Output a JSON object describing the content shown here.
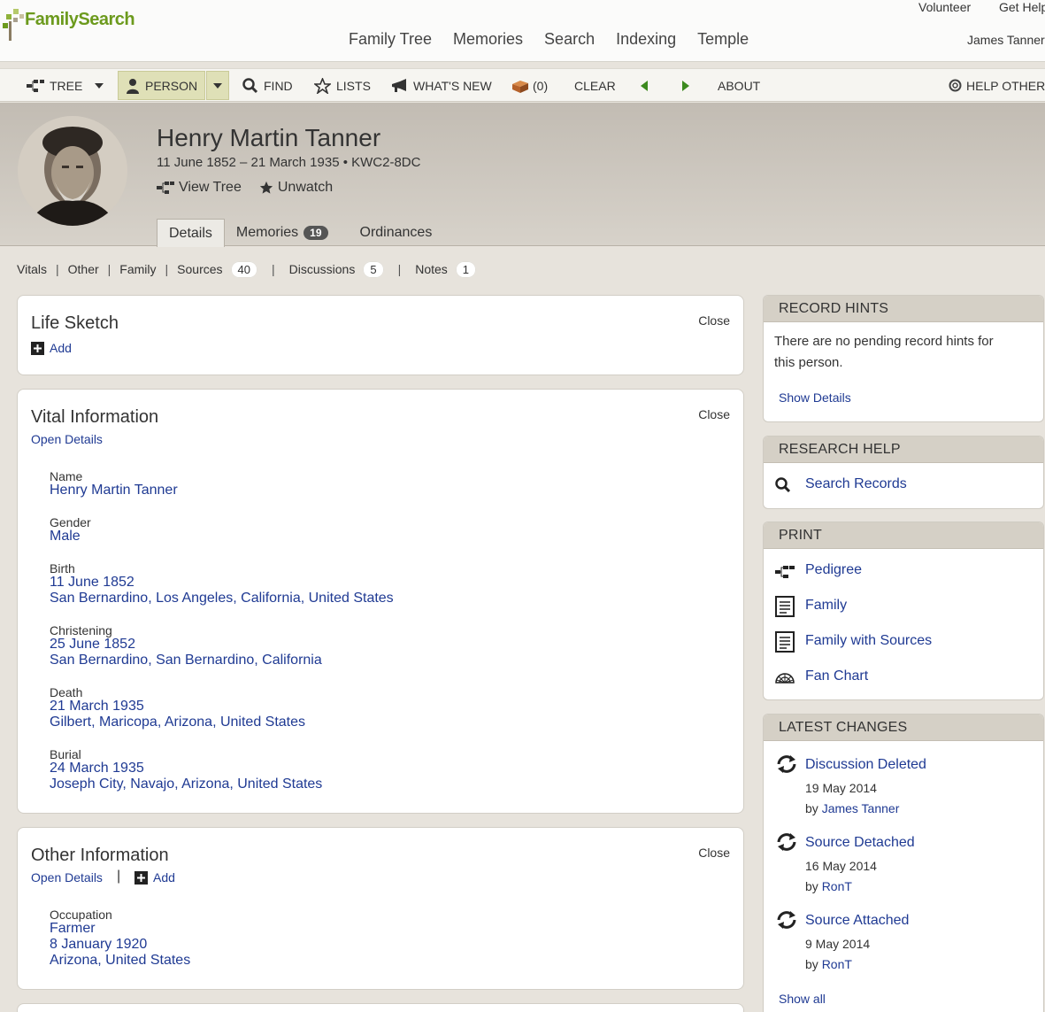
{
  "header": {
    "logo_text": "FamilySearch",
    "nav": [
      "Family Tree",
      "Memories",
      "Search",
      "Indexing",
      "Temple"
    ],
    "utility": [
      "Volunteer",
      "Get Help"
    ],
    "user_name": "James Tanner"
  },
  "toolbar": {
    "tree": "TREE",
    "person": "PERSON",
    "find": "FIND",
    "lists": "LISTS",
    "whats_new": "WHAT'S NEW",
    "clipboard": "(0)",
    "clear": "CLEAR",
    "about": "ABOUT",
    "help_others": "HELP OTHERS"
  },
  "person": {
    "name": "Henry Martin Tanner",
    "summary": "11 June 1852 – 21 March 1935 • KWC2-8DC",
    "view_tree": "View Tree",
    "unwatch": "Unwatch",
    "tabs": [
      {
        "label": "Details"
      },
      {
        "label": "Memories",
        "count": "19"
      },
      {
        "label": "Ordinances"
      }
    ]
  },
  "subnav": [
    {
      "label": "Vitals"
    },
    {
      "label": "Other"
    },
    {
      "label": "Family"
    },
    {
      "label": "Sources",
      "count": "40"
    },
    {
      "label": "Discussions",
      "count": "5"
    },
    {
      "label": "Notes",
      "count": "1"
    }
  ],
  "life_sketch": {
    "title": "Life Sketch",
    "close": "Close",
    "add": "Add"
  },
  "vital": {
    "title": "Vital Information",
    "close": "Close",
    "open_details": "Open Details",
    "name_label": "Name",
    "name_value": "Henry Martin Tanner",
    "gender_label": "Gender",
    "gender_value": "Male",
    "birth_label": "Birth",
    "birth_date": "11 June 1852",
    "birth_place": "San Bernardino, Los Angeles, California, United States",
    "christening_label": "Christening",
    "christening_date": "25 June 1852",
    "christening_place": "San Bernardino, San Bernardino, California",
    "death_label": "Death",
    "death_date": "21 March 1935",
    "death_place": "Gilbert, Maricopa, Arizona, United States",
    "burial_label": "Burial",
    "burial_date": "24 March 1935",
    "burial_place": "Joseph City, Navajo, Arizona, United States"
  },
  "other": {
    "title": "Other Information",
    "close": "Close",
    "open_details": "Open Details",
    "add": "Add",
    "occupation_label": "Occupation",
    "occupation_value": "Farmer",
    "occupation_date": "8 January 1920",
    "occupation_place": "Arizona, United States"
  },
  "record_hints": {
    "title": "RECORD HINTS",
    "text_line1": "There are no pending record hints for",
    "text_line2": "this person.",
    "show_details": "Show Details"
  },
  "research_help": {
    "title": "RESEARCH HELP",
    "search_records": "Search Records"
  },
  "print": {
    "title": "PRINT",
    "items": [
      "Pedigree",
      "Family",
      "Family with Sources",
      "Fan Chart"
    ]
  },
  "latest_changes": {
    "title": "LATEST CHANGES",
    "items": [
      {
        "title": "Discussion Deleted",
        "date": "19 May 2014",
        "by": "by",
        "who": "James Tanner"
      },
      {
        "title": "Source Detached",
        "date": "16 May 2014",
        "by": "by",
        "who": "RonT"
      },
      {
        "title": "Source Attached",
        "date": "9 May 2014",
        "by": "by",
        "who": "RonT"
      }
    ],
    "show_all": "Show all"
  },
  "colors": {
    "brand_green": "#6c9a1d",
    "link_blue": "#1f3a93",
    "person_button": "#dfe0b7",
    "header_bg": "#c2bcb3"
  }
}
